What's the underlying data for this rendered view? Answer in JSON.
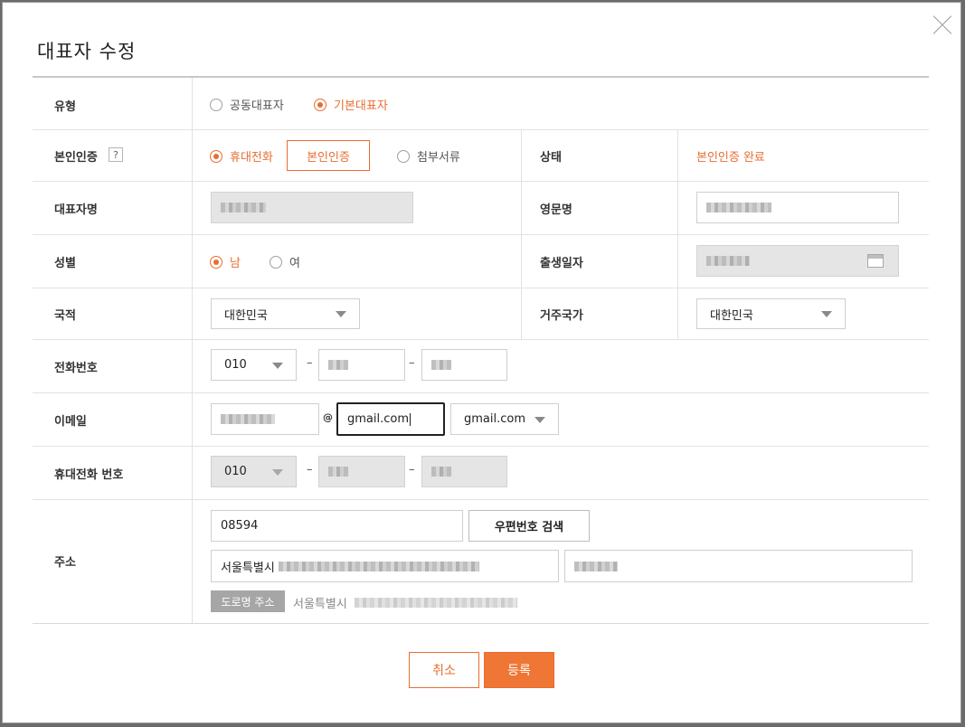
{
  "modal": {
    "title": "대표자 수정",
    "close_icon": "close-icon"
  },
  "type": {
    "label": "유형",
    "options": [
      "공동대표자",
      "기본대표자"
    ],
    "selected": "기본대표자"
  },
  "verify": {
    "label": "본인인증",
    "help": "?",
    "options": [
      "휴대전화",
      "첨부서류"
    ],
    "selected": "휴대전화",
    "button": "본인인증",
    "status_label": "상태",
    "status_value": "본인인증 완료"
  },
  "name": {
    "label": "대표자명",
    "english_label": "영문명"
  },
  "gender": {
    "label": "성별",
    "options": [
      "남",
      "여"
    ],
    "selected": "남",
    "birth_label": "출생일자"
  },
  "nationality": {
    "label": "국적",
    "value": "대한민국",
    "residence_label": "거주국가",
    "residence_value": "대한민국"
  },
  "phone": {
    "label": "전화번호",
    "prefix": "010",
    "dash": "–"
  },
  "email": {
    "label": "이메일",
    "at": "@",
    "domain_input": "gmail.com",
    "domain_select": "gmail.com"
  },
  "mobile": {
    "label": "휴대전화 번호",
    "prefix": "010",
    "dash": "–"
  },
  "address": {
    "label": "주소",
    "zipcode": "08594",
    "search_button": "우편번호 검색",
    "line1_prefix": "서울특별시",
    "road_tag": "도로명 주소",
    "road_prefix": "서울특별시"
  },
  "footer": {
    "cancel": "취소",
    "submit": "등록"
  },
  "colors": {
    "accent": "#e86d31",
    "disabled_bg": "#e5e5e5"
  }
}
